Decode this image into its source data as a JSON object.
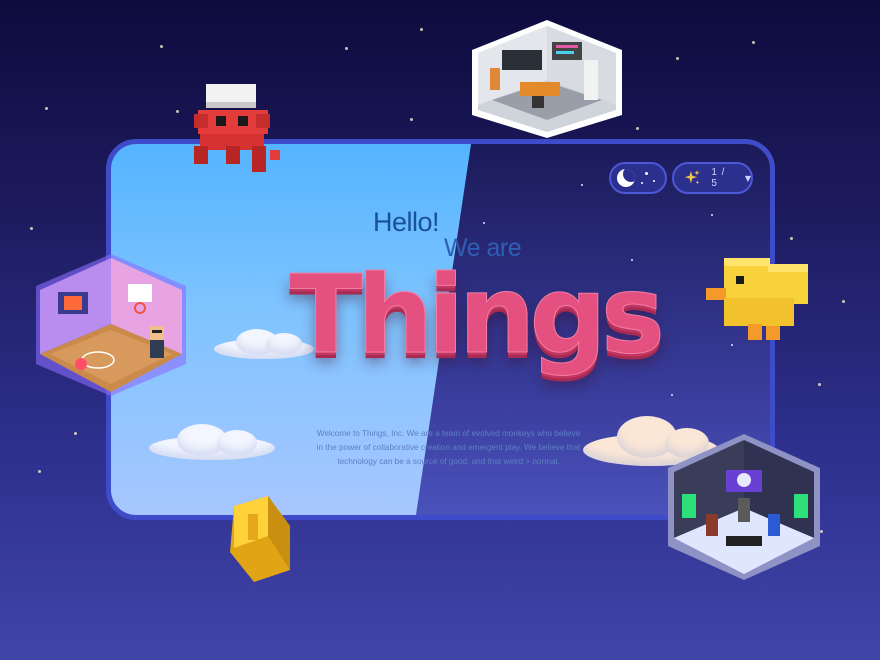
{
  "hero": {
    "greeting": "Hello!",
    "intro": "We are",
    "brand": "Things",
    "description": "Welcome to Things, Inc. We are a team of evolved monkeys who believe in the power of collaborative creation and emergent play. We believe that technology can be a source of good, and that weird > normal."
  },
  "controls": {
    "theme_toggle_icon": "moon-icon",
    "pager_icon": "sparkle-icon",
    "pager_label": "1 / 5",
    "pager_chevron_icon": "chevron-down-icon"
  },
  "colors": {
    "background_top": "#0e0b3e",
    "background_bottom": "#4045a8",
    "card_border": "#3f4cc9",
    "day_sky": "#54b4ff",
    "brand_pink": "#e4507f",
    "greeting_blue": "#1a4f9a"
  }
}
